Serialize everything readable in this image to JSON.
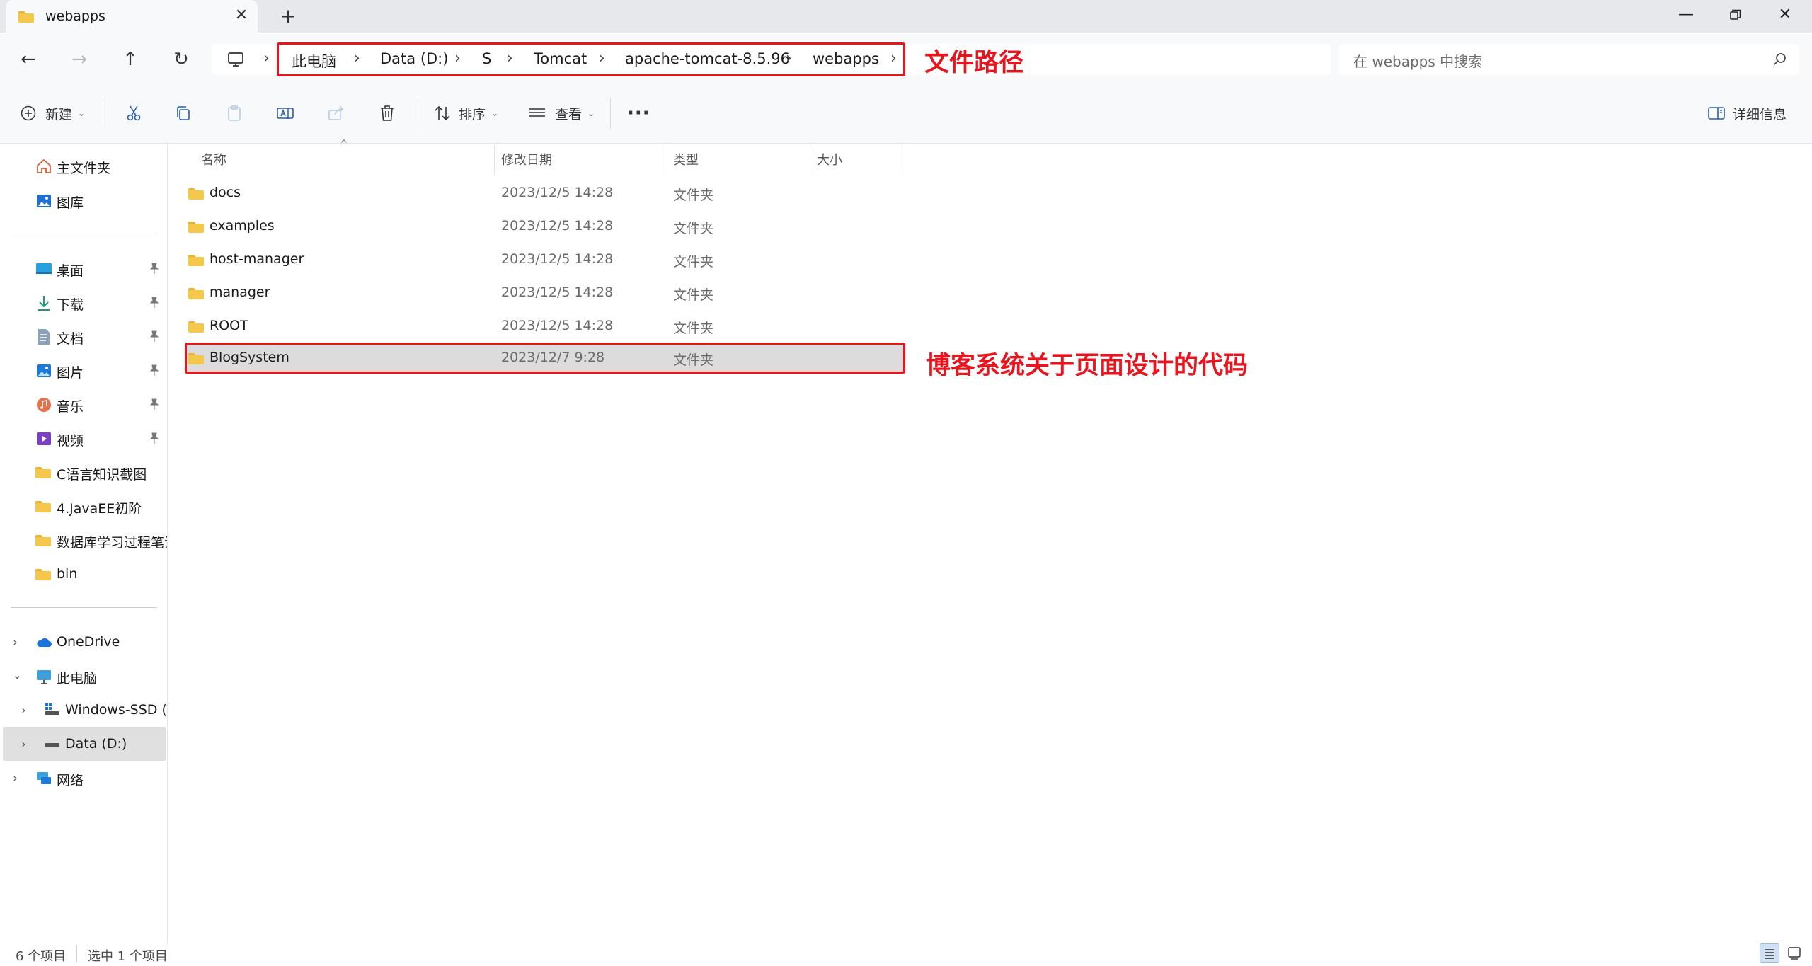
{
  "tab": {
    "title": "webapps"
  },
  "address": {
    "crumbs": [
      "此电脑",
      "Data (D:)",
      "S",
      "Tomcat",
      "apache-tomcat-8.5.96",
      "webapps"
    ]
  },
  "search": {
    "placeholder": "在 webapps 中搜索"
  },
  "commandbar": {
    "new_label": "新建",
    "sort_label": "排序",
    "view_label": "查看",
    "details_label": "详细信息"
  },
  "sidebar": {
    "home": "主文件夹",
    "gallery": "图库",
    "quick": [
      "桌面",
      "下载",
      "文档",
      "图片",
      "音乐",
      "视频"
    ],
    "folders": [
      "C语言知识截图",
      "4.JavaEE初阶",
      "数据库学习过程笔记",
      "bin"
    ],
    "onedrive": "OneDrive",
    "this_pc": "此电脑",
    "drive_c": "Windows-SSD (C:)",
    "drive_d": "Data (D:)",
    "network": "网络"
  },
  "columns": {
    "name": "名称",
    "modified": "修改日期",
    "type": "类型",
    "size": "大小"
  },
  "files": [
    {
      "name": "docs",
      "modified": "2023/12/5 14:28",
      "type": "文件夹"
    },
    {
      "name": "examples",
      "modified": "2023/12/5 14:28",
      "type": "文件夹"
    },
    {
      "name": "host-manager",
      "modified": "2023/12/5 14:28",
      "type": "文件夹"
    },
    {
      "name": "manager",
      "modified": "2023/12/5 14:28",
      "type": "文件夹"
    },
    {
      "name": "ROOT",
      "modified": "2023/12/5 14:28",
      "type": "文件夹"
    },
    {
      "name": "BlogSystem",
      "modified": "2023/12/7 9:28",
      "type": "文件夹"
    }
  ],
  "annotations": {
    "path_label": "文件路径",
    "blog_label": "博客系统关于页面设计的代码",
    "color": "#e8141e"
  },
  "status": {
    "items": "6 个项目",
    "selected": "选中 1 个项目"
  }
}
